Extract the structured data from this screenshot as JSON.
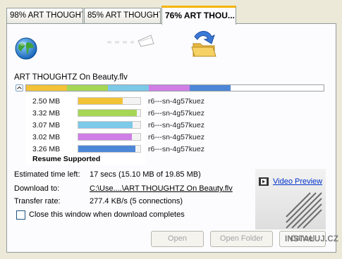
{
  "tabs": [
    {
      "label": "98% ART THOUGHT..."
    },
    {
      "label": "85% ART THOUGHT..."
    },
    {
      "label": "76% ART THOU..."
    }
  ],
  "file_name": "ART THOUGHTZ On Beauty.flv",
  "connections": [
    {
      "size": "2.50 MB",
      "color": "#f2c237",
      "fill": 0.72,
      "id": "r6---sn-4g57kuez"
    },
    {
      "size": "3.32 MB",
      "color": "#a6d656",
      "fill": 0.94,
      "id": "r6---sn-4g57kuez"
    },
    {
      "size": "3.07 MB",
      "color": "#7cc9e8",
      "fill": 0.88,
      "id": "r6---sn-4g57kuez"
    },
    {
      "size": "3.02 MB",
      "color": "#cf7ee6",
      "fill": 0.86,
      "id": "r6---sn-4g57kuez"
    },
    {
      "size": "3.26 MB",
      "color": "#4d87d8",
      "fill": 0.92,
      "id": "r6---sn-4g57kuez"
    }
  ],
  "overall_segments": [
    {
      "color": "#f2c237"
    },
    {
      "color": "#a6d656"
    },
    {
      "color": "#7cc9e8"
    },
    {
      "color": "#cf7ee6"
    },
    {
      "color": "#4d87d8"
    }
  ],
  "resume_status": "Resume Supported",
  "details": {
    "time_left_label": "Estimated time left:",
    "time_left_value": "17 secs (15.10 MB of 19.85 MB)",
    "download_to_label": "Download to:",
    "download_to_value": "C:\\Use....\\ART THOUGHTZ On Beauty.flv",
    "transfer_rate_label": "Transfer rate:",
    "transfer_rate_value": "277.4 KB/s (5 connections)"
  },
  "video_preview_label": "Video Preview",
  "close_checkbox_label": "Close this window when download completes",
  "buttons": {
    "open": "Open",
    "open_folder": "Open Folder",
    "cancel": "Cancel"
  },
  "watermark_text": "INSTALUJ.CZ",
  "colors": {
    "tab_accent": "#f4b400",
    "link": "#0033cc",
    "accent_blue": "#3a78d8"
  }
}
